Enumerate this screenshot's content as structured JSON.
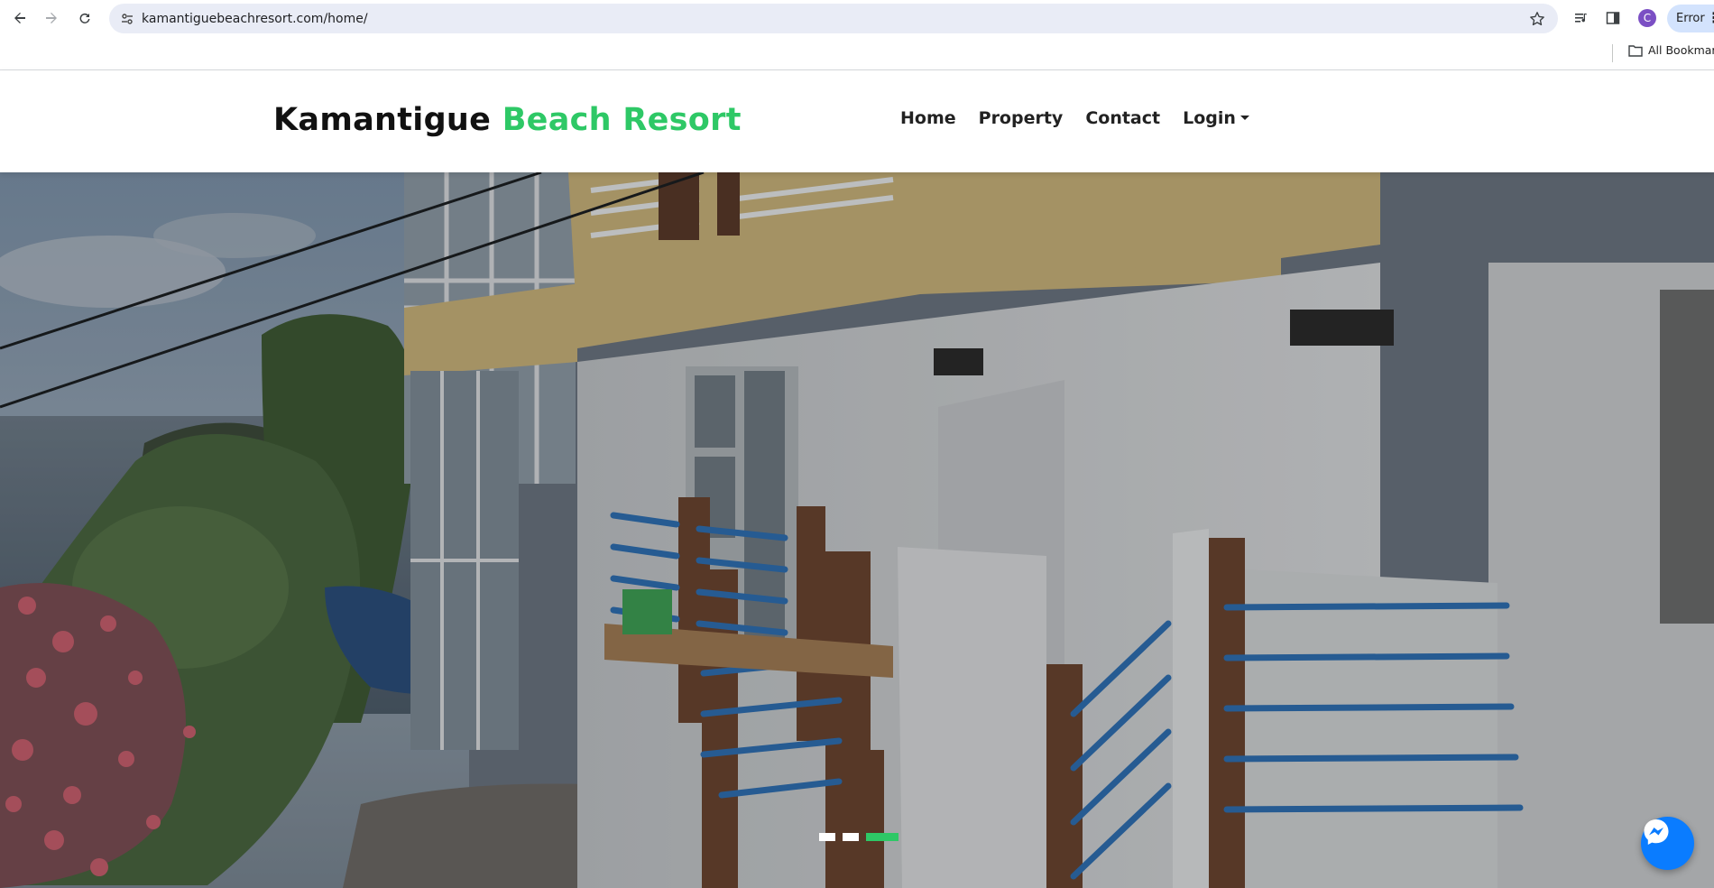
{
  "browser": {
    "url": "kamantiguebeachresort.com/home/",
    "profile_initial": "C",
    "error_label": "Error",
    "bookmarks_label": "All Bookmarks"
  },
  "site": {
    "logo_part1": "Kamantigue",
    "logo_part2": "Beach Resort",
    "logo_colors": {
      "part1": "#111111",
      "part2": "#2ec866"
    },
    "nav": [
      {
        "label": "Home"
      },
      {
        "label": "Property"
      },
      {
        "label": "Contact"
      },
      {
        "label": "Login",
        "dropdown": true
      }
    ]
  },
  "hero": {
    "image": "resort-building-photo",
    "slides_total": 3,
    "active_slide": 3,
    "accent_color": "#2ec866"
  },
  "chat": {
    "icon": "messenger-icon",
    "color": "#0a7cff"
  }
}
